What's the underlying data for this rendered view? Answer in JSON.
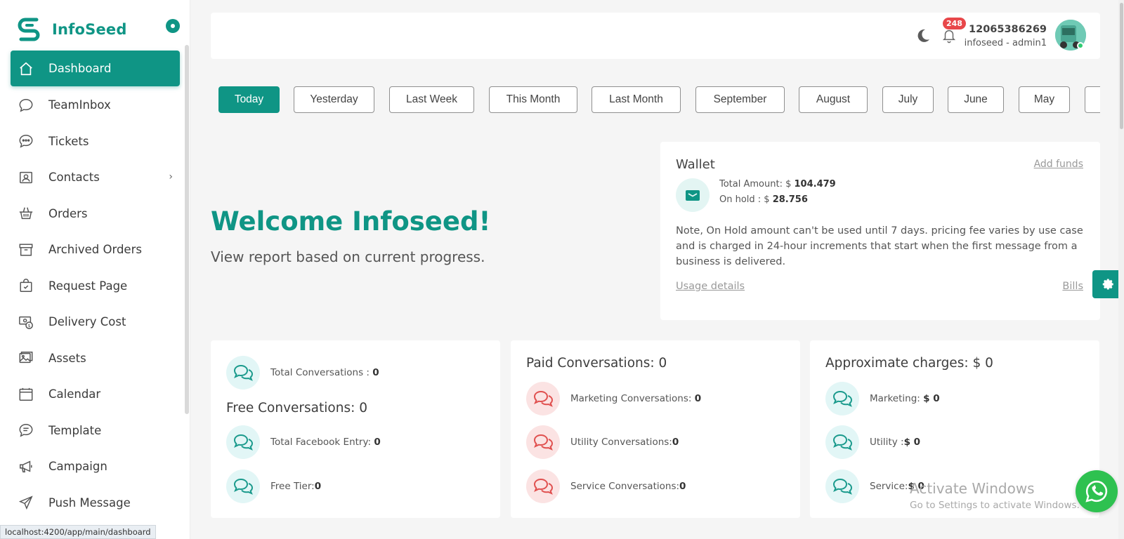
{
  "brand": {
    "name": "InfoSeed",
    "accent": "#0f9585"
  },
  "sidebar": {
    "items": [
      {
        "label": "Dashboard",
        "icon": "home-icon",
        "active": true
      },
      {
        "label": "TeamInbox",
        "icon": "chat-bubble-icon"
      },
      {
        "label": "Tickets",
        "icon": "chat-dots-icon"
      },
      {
        "label": "Contacts",
        "icon": "contact-card-icon",
        "chevron": "›"
      },
      {
        "label": "Orders",
        "icon": "basket-icon"
      },
      {
        "label": "Archived Orders",
        "icon": "archive-icon"
      },
      {
        "label": "Request Page",
        "icon": "bag-check-icon"
      },
      {
        "label": "Delivery Cost",
        "icon": "cash-icon"
      },
      {
        "label": "Assets",
        "icon": "images-icon"
      },
      {
        "label": "Calendar",
        "icon": "calendar-icon"
      },
      {
        "label": "Template",
        "icon": "chat-text-icon"
      },
      {
        "label": "Campaign",
        "icon": "megaphone-icon"
      },
      {
        "label": "Push Message",
        "icon": "send-icon"
      }
    ]
  },
  "statusbar": {
    "url": "localhost:4200/app/main/dashboard"
  },
  "header": {
    "notifications": "248",
    "user_phone": "12065386269",
    "user_role": "infoseed - admin1"
  },
  "filters": [
    "Today",
    "Yesterday",
    "Last Week",
    "This Month",
    "Last Month",
    "September",
    "August",
    "July",
    "June",
    "May"
  ],
  "welcome": {
    "title": "Welcome Infoseed!",
    "subtitle": "View report based on current progress."
  },
  "wallet": {
    "title": "Wallet",
    "add_funds": "Add funds",
    "total_label": "Total Amount: $ ",
    "total_value": "104.479",
    "hold_label": "On hold : $ ",
    "hold_value": "28.756",
    "note": "Note, On Hold amount can't be used until 7 days. pricing fee varies by use case and is charged in 24-hour increments that start when the first message from a business is delivered.",
    "usage_details": "Usage details",
    "bills": "Bills"
  },
  "cards": {
    "total": {
      "label": "Total Conversations : ",
      "value": "0"
    },
    "free": {
      "title": "Free Conversations: 0",
      "facebook_label": "Total Facebook Entry: ",
      "facebook_value": "0",
      "tier_label": "Free Tier:",
      "tier_value": "0"
    },
    "paid": {
      "title": "Paid Conversations: 0",
      "marketing_label": "Marketing Conversations: ",
      "marketing_value": "0",
      "utility_label": "Utility Conversations:",
      "utility_value": "0",
      "service_label": "Service Conversations:",
      "service_value": "0"
    },
    "charges": {
      "title": "Approximate charges: $ 0",
      "marketing_label": "Marketing: ",
      "marketing_value": "$ 0",
      "utility_label": "Utility :",
      "utility_value": "$ 0",
      "service_label": "Service:",
      "service_value": "$ 0"
    }
  },
  "watermark": {
    "line1": "Activate Windows",
    "line2": "Go to Settings to activate Windows."
  }
}
